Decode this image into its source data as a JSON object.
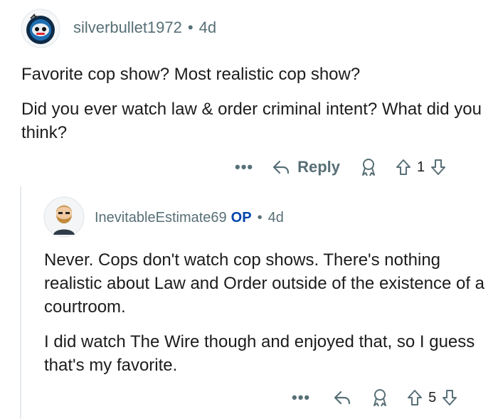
{
  "comment1": {
    "username": "silverbullet1972",
    "separator": "•",
    "age": "4d",
    "paragraphs": [
      "Favorite cop show? Most realistic cop show?",
      "Did you ever watch law & order criminal intent? What did you think?"
    ],
    "actions": {
      "more": "•••",
      "reply_label": "Reply",
      "votes": "1"
    }
  },
  "comment2": {
    "username": "InevitableEstimate69",
    "op_badge": "OP",
    "separator": "•",
    "age": "4d",
    "paragraphs": [
      "Never. Cops don't watch cop shows. There's nothing realistic about Law and Order outside of the existence of a courtroom.",
      "I did watch The Wire though and enjoyed that, so I guess that's my favorite."
    ],
    "actions": {
      "more": "•••",
      "votes": "5"
    }
  },
  "colors": {
    "meta_gray": "#576f76",
    "op_blue": "#0045ac",
    "text": "#1c1c1c",
    "thread_line": "#e5ebee"
  },
  "icons": [
    "avatar-robot",
    "avatar-bearded-man",
    "reply-arrow-icon",
    "award-icon",
    "upvote-icon",
    "downvote-icon"
  ]
}
